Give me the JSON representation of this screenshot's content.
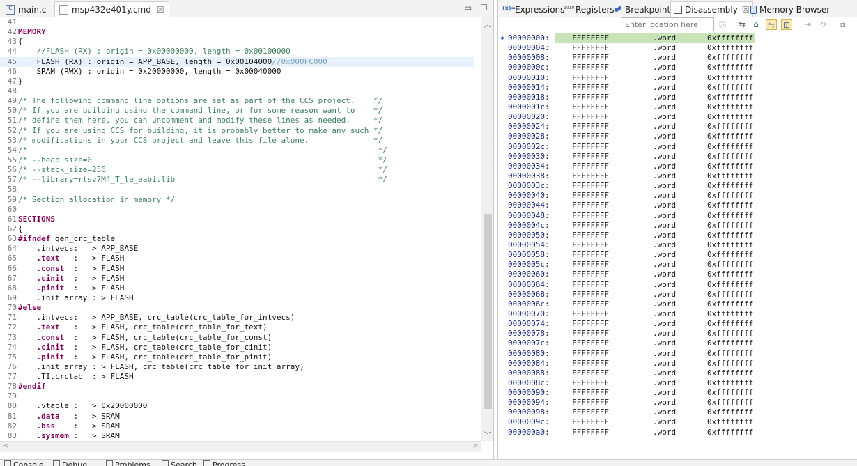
{
  "editor": {
    "tabs": [
      {
        "label": "main.c",
        "icon": "c-file-icon"
      },
      {
        "label": "msp432e401y.cmd",
        "icon": "cmd-file-icon",
        "close": "☒"
      }
    ],
    "window_buttons": {
      "minimize": "▭",
      "maximize": "☐"
    },
    "lines": [
      {
        "n": "41",
        "parts": [
          {
            "t": "",
            "c": "lt"
          }
        ]
      },
      {
        "n": "42",
        "parts": [
          {
            "t": "MEMORY",
            "c": "kw"
          }
        ]
      },
      {
        "n": "43",
        "parts": [
          {
            "t": "{",
            "c": "lt"
          }
        ]
      },
      {
        "n": "44",
        "parts": [
          {
            "t": "    //FLASH (RX) : origin = 0x00000000, length = 0x00100000",
            "c": "cm"
          }
        ]
      },
      {
        "n": "45",
        "hl": true,
        "parts": [
          {
            "t": "    FLASH (RX) : origin = APP_BASE, length = 0x00104000",
            "c": "lt"
          },
          {
            "t": "//0x000FC000",
            "c": "cmlight"
          }
        ]
      },
      {
        "n": "46",
        "parts": [
          {
            "t": "    SRAM (RWX) : origin = 0x20000000, length = 0x00040000",
            "c": "lt"
          }
        ]
      },
      {
        "n": "47",
        "parts": [
          {
            "t": "}",
            "c": "lt"
          }
        ]
      },
      {
        "n": "48",
        "parts": [
          {
            "t": "",
            "c": "lt"
          }
        ]
      },
      {
        "n": "49",
        "parts": [
          {
            "t": "/* The following command line options are set as part of the CCS project.    */",
            "c": "cm"
          }
        ]
      },
      {
        "n": "50",
        "parts": [
          {
            "t": "/* If you are building using the command line, or for some reason want to    */",
            "c": "cm"
          }
        ]
      },
      {
        "n": "51",
        "parts": [
          {
            "t": "/* define them here, you can uncomment and modify these lines as needed.     */",
            "c": "cm"
          }
        ]
      },
      {
        "n": "52",
        "parts": [
          {
            "t": "/* If you are using CCS for building, it is probably better to make any such */",
            "c": "cm"
          }
        ]
      },
      {
        "n": "53",
        "parts": [
          {
            "t": "/* modifications in your CCS project and leave this file alone.              */",
            "c": "cm"
          }
        ]
      },
      {
        "n": "54",
        "parts": [
          {
            "t": "/*                                                                            */",
            "c": "cm"
          }
        ]
      },
      {
        "n": "55",
        "parts": [
          {
            "t": "/* --heap_size=0                                                              */",
            "c": "cm"
          }
        ]
      },
      {
        "n": "56",
        "parts": [
          {
            "t": "/* --stack_size=256                                                           */",
            "c": "cm"
          }
        ]
      },
      {
        "n": "57",
        "parts": [
          {
            "t": "/* --library=rtsv7M4_T_le_eabi.lib                                            */",
            "c": "cm"
          }
        ]
      },
      {
        "n": "58",
        "parts": [
          {
            "t": "",
            "c": "lt"
          }
        ]
      },
      {
        "n": "59",
        "parts": [
          {
            "t": "/* Section allocation in memory */",
            "c": "cm"
          }
        ]
      },
      {
        "n": "60",
        "parts": [
          {
            "t": "",
            "c": "lt"
          }
        ]
      },
      {
        "n": "61",
        "parts": [
          {
            "t": "SECTIONS",
            "c": "kw"
          }
        ]
      },
      {
        "n": "62",
        "parts": [
          {
            "t": "{",
            "c": "lt"
          }
        ]
      },
      {
        "n": "63",
        "parts": [
          {
            "t": "#ifndef",
            "c": "kw"
          },
          {
            "t": " gen_crc_table",
            "c": "lt"
          }
        ]
      },
      {
        "n": "64",
        "parts": [
          {
            "t": "    .intvecs:   > APP_BASE",
            "c": "lt"
          }
        ]
      },
      {
        "n": "65",
        "parts": [
          {
            "t": "    ",
            "c": "lt"
          },
          {
            "t": ".text",
            "c": "kw"
          },
          {
            "t": "   :   > FLASH",
            "c": "lt"
          }
        ]
      },
      {
        "n": "66",
        "parts": [
          {
            "t": "    ",
            "c": "lt"
          },
          {
            "t": ".const",
            "c": "kw"
          },
          {
            "t": "  :   > FLASH",
            "c": "lt"
          }
        ]
      },
      {
        "n": "67",
        "parts": [
          {
            "t": "    ",
            "c": "lt"
          },
          {
            "t": ".cinit",
            "c": "kw"
          },
          {
            "t": "  :   > FLASH",
            "c": "lt"
          }
        ]
      },
      {
        "n": "68",
        "parts": [
          {
            "t": "    ",
            "c": "lt"
          },
          {
            "t": ".pinit",
            "c": "kw"
          },
          {
            "t": "  :   > FLASH",
            "c": "lt"
          }
        ]
      },
      {
        "n": "69",
        "parts": [
          {
            "t": "    .init_array : > FLASH",
            "c": "lt"
          }
        ]
      },
      {
        "n": "70",
        "parts": [
          {
            "t": "#else",
            "c": "kw"
          }
        ]
      },
      {
        "n": "71",
        "parts": [
          {
            "t": "    .intvecs:   > APP_BASE, crc_table(crc_table_for_intvecs)",
            "c": "lt"
          }
        ]
      },
      {
        "n": "72",
        "parts": [
          {
            "t": "    ",
            "c": "lt"
          },
          {
            "t": ".text",
            "c": "kw"
          },
          {
            "t": "   :   > FLASH, crc_table(crc_table_for_text)",
            "c": "lt"
          }
        ]
      },
      {
        "n": "73",
        "parts": [
          {
            "t": "    ",
            "c": "lt"
          },
          {
            "t": ".const",
            "c": "kw"
          },
          {
            "t": "  :   > FLASH, crc_table(crc_table_for_const)",
            "c": "lt"
          }
        ]
      },
      {
        "n": "74",
        "parts": [
          {
            "t": "    ",
            "c": "lt"
          },
          {
            "t": ".cinit",
            "c": "kw"
          },
          {
            "t": "  :   > FLASH, crc_table(crc_table_for_cinit)",
            "c": "lt"
          }
        ]
      },
      {
        "n": "75",
        "parts": [
          {
            "t": "    ",
            "c": "lt"
          },
          {
            "t": ".pinit",
            "c": "kw"
          },
          {
            "t": "  :   > FLASH, crc_table(crc_table_for_pinit)",
            "c": "lt"
          }
        ]
      },
      {
        "n": "76",
        "parts": [
          {
            "t": "    .init_array : > FLASH, crc_table(crc_table_for_init_array)",
            "c": "lt"
          }
        ]
      },
      {
        "n": "77",
        "parts": [
          {
            "t": "    .TI.crctab  : > FLASH",
            "c": "lt"
          }
        ]
      },
      {
        "n": "78",
        "parts": [
          {
            "t": "#endif",
            "c": "kw"
          }
        ]
      },
      {
        "n": "79",
        "parts": [
          {
            "t": "",
            "c": "lt"
          }
        ]
      },
      {
        "n": "80",
        "parts": [
          {
            "t": "    .vtable :   > 0x20000000",
            "c": "lt"
          }
        ]
      },
      {
        "n": "81",
        "parts": [
          {
            "t": "    ",
            "c": "lt"
          },
          {
            "t": ".data",
            "c": "kw"
          },
          {
            "t": "   :   > SRAM",
            "c": "lt"
          }
        ]
      },
      {
        "n": "82",
        "parts": [
          {
            "t": "    ",
            "c": "lt"
          },
          {
            "t": ".bss",
            "c": "kw"
          },
          {
            "t": "    :   > SRAM",
            "c": "lt"
          }
        ]
      },
      {
        "n": "83",
        "parts": [
          {
            "t": "    ",
            "c": "lt"
          },
          {
            "t": ".sysmem",
            "c": "kw"
          },
          {
            "t": " :   > SRAM",
            "c": "lt"
          }
        ]
      }
    ]
  },
  "views": {
    "tabs": [
      {
        "label": "Expressions",
        "icon": "expressions-icon"
      },
      {
        "label": "Registers",
        "icon": "registers-icon"
      },
      {
        "label": "Breakpoints",
        "icon": "breakpoints-icon"
      },
      {
        "label": "Disassembly",
        "icon": "disassembly-icon",
        "close": "☒"
      },
      {
        "label": "Memory Browser",
        "icon": "memory-browser-icon"
      }
    ],
    "location_placeholder": "Enter location here"
  },
  "disassembly": {
    "current_marker": "◆",
    "rows": [
      {
        "addr": "00000000:",
        "op": "FFFFFFFF",
        "mn": ".word",
        "arg": "0xffffffff",
        "cur": true
      },
      {
        "addr": "00000004:",
        "op": "FFFFFFFF",
        "mn": ".word",
        "arg": "0xffffffff"
      },
      {
        "addr": "00000008:",
        "op": "FFFFFFFF",
        "mn": ".word",
        "arg": "0xffffffff"
      },
      {
        "addr": "0000000c:",
        "op": "FFFFFFFF",
        "mn": ".word",
        "arg": "0xffffffff"
      },
      {
        "addr": "00000010:",
        "op": "FFFFFFFF",
        "mn": ".word",
        "arg": "0xffffffff"
      },
      {
        "addr": "00000014:",
        "op": "FFFFFFFF",
        "mn": ".word",
        "arg": "0xffffffff"
      },
      {
        "addr": "00000018:",
        "op": "FFFFFFFF",
        "mn": ".word",
        "arg": "0xffffffff"
      },
      {
        "addr": "0000001c:",
        "op": "FFFFFFFF",
        "mn": ".word",
        "arg": "0xffffffff"
      },
      {
        "addr": "00000020:",
        "op": "FFFFFFFF",
        "mn": ".word",
        "arg": "0xffffffff"
      },
      {
        "addr": "00000024:",
        "op": "FFFFFFFF",
        "mn": ".word",
        "arg": "0xffffffff"
      },
      {
        "addr": "00000028:",
        "op": "FFFFFFFF",
        "mn": ".word",
        "arg": "0xffffffff"
      },
      {
        "addr": "0000002c:",
        "op": "FFFFFFFF",
        "mn": ".word",
        "arg": "0xffffffff"
      },
      {
        "addr": "00000030:",
        "op": "FFFFFFFF",
        "mn": ".word",
        "arg": "0xffffffff"
      },
      {
        "addr": "00000034:",
        "op": "FFFFFFFF",
        "mn": ".word",
        "arg": "0xffffffff"
      },
      {
        "addr": "00000038:",
        "op": "FFFFFFFF",
        "mn": ".word",
        "arg": "0xffffffff"
      },
      {
        "addr": "0000003c:",
        "op": "FFFFFFFF",
        "mn": ".word",
        "arg": "0xffffffff"
      },
      {
        "addr": "00000040:",
        "op": "FFFFFFFF",
        "mn": ".word",
        "arg": "0xffffffff"
      },
      {
        "addr": "00000044:",
        "op": "FFFFFFFF",
        "mn": ".word",
        "arg": "0xffffffff"
      },
      {
        "addr": "00000048:",
        "op": "FFFFFFFF",
        "mn": ".word",
        "arg": "0xffffffff"
      },
      {
        "addr": "0000004c:",
        "op": "FFFFFFFF",
        "mn": ".word",
        "arg": "0xffffffff"
      },
      {
        "addr": "00000050:",
        "op": "FFFFFFFF",
        "mn": ".word",
        "arg": "0xffffffff"
      },
      {
        "addr": "00000054:",
        "op": "FFFFFFFF",
        "mn": ".word",
        "arg": "0xffffffff"
      },
      {
        "addr": "00000058:",
        "op": "FFFFFFFF",
        "mn": ".word",
        "arg": "0xffffffff"
      },
      {
        "addr": "0000005c:",
        "op": "FFFFFFFF",
        "mn": ".word",
        "arg": "0xffffffff"
      },
      {
        "addr": "00000060:",
        "op": "FFFFFFFF",
        "mn": ".word",
        "arg": "0xffffffff"
      },
      {
        "addr": "00000064:",
        "op": "FFFFFFFF",
        "mn": ".word",
        "arg": "0xffffffff"
      },
      {
        "addr": "00000068:",
        "op": "FFFFFFFF",
        "mn": ".word",
        "arg": "0xffffffff"
      },
      {
        "addr": "0000006c:",
        "op": "FFFFFFFF",
        "mn": ".word",
        "arg": "0xffffffff"
      },
      {
        "addr": "00000070:",
        "op": "FFFFFFFF",
        "mn": ".word",
        "arg": "0xffffffff"
      },
      {
        "addr": "00000074:",
        "op": "FFFFFFFF",
        "mn": ".word",
        "arg": "0xffffffff"
      },
      {
        "addr": "00000078:",
        "op": "FFFFFFFF",
        "mn": ".word",
        "arg": "0xffffffff"
      },
      {
        "addr": "0000007c:",
        "op": "FFFFFFFF",
        "mn": ".word",
        "arg": "0xffffffff"
      },
      {
        "addr": "00000080:",
        "op": "FFFFFFFF",
        "mn": ".word",
        "arg": "0xffffffff"
      },
      {
        "addr": "00000084:",
        "op": "FFFFFFFF",
        "mn": ".word",
        "arg": "0xffffffff"
      },
      {
        "addr": "00000088:",
        "op": "FFFFFFFF",
        "mn": ".word",
        "arg": "0xffffffff"
      },
      {
        "addr": "0000008c:",
        "op": "FFFFFFFF",
        "mn": ".word",
        "arg": "0xffffffff"
      },
      {
        "addr": "00000090:",
        "op": "FFFFFFFF",
        "mn": ".word",
        "arg": "0xffffffff"
      },
      {
        "addr": "00000094:",
        "op": "FFFFFFFF",
        "mn": ".word",
        "arg": "0xffffffff"
      },
      {
        "addr": "00000098:",
        "op": "FFFFFFFF",
        "mn": ".word",
        "arg": "0xffffffff"
      },
      {
        "addr": "0000009c:",
        "op": "FFFFFFFF",
        "mn": ".word",
        "arg": "0xffffffff"
      },
      {
        "addr": "000000a0:",
        "op": "FFFFFFFF",
        "mn": ".word",
        "arg": "0xffffffff"
      }
    ]
  },
  "bottom": {
    "tabs": [
      {
        "label": "Console",
        "icon": "console-icon"
      },
      {
        "label": "Debug",
        "icon": "debug-icon"
      },
      {
        "label": "Problems",
        "icon": "problems-icon"
      },
      {
        "label": "Search",
        "icon": "search-icon"
      },
      {
        "label": "Progress",
        "icon": "progress-icon"
      }
    ]
  }
}
